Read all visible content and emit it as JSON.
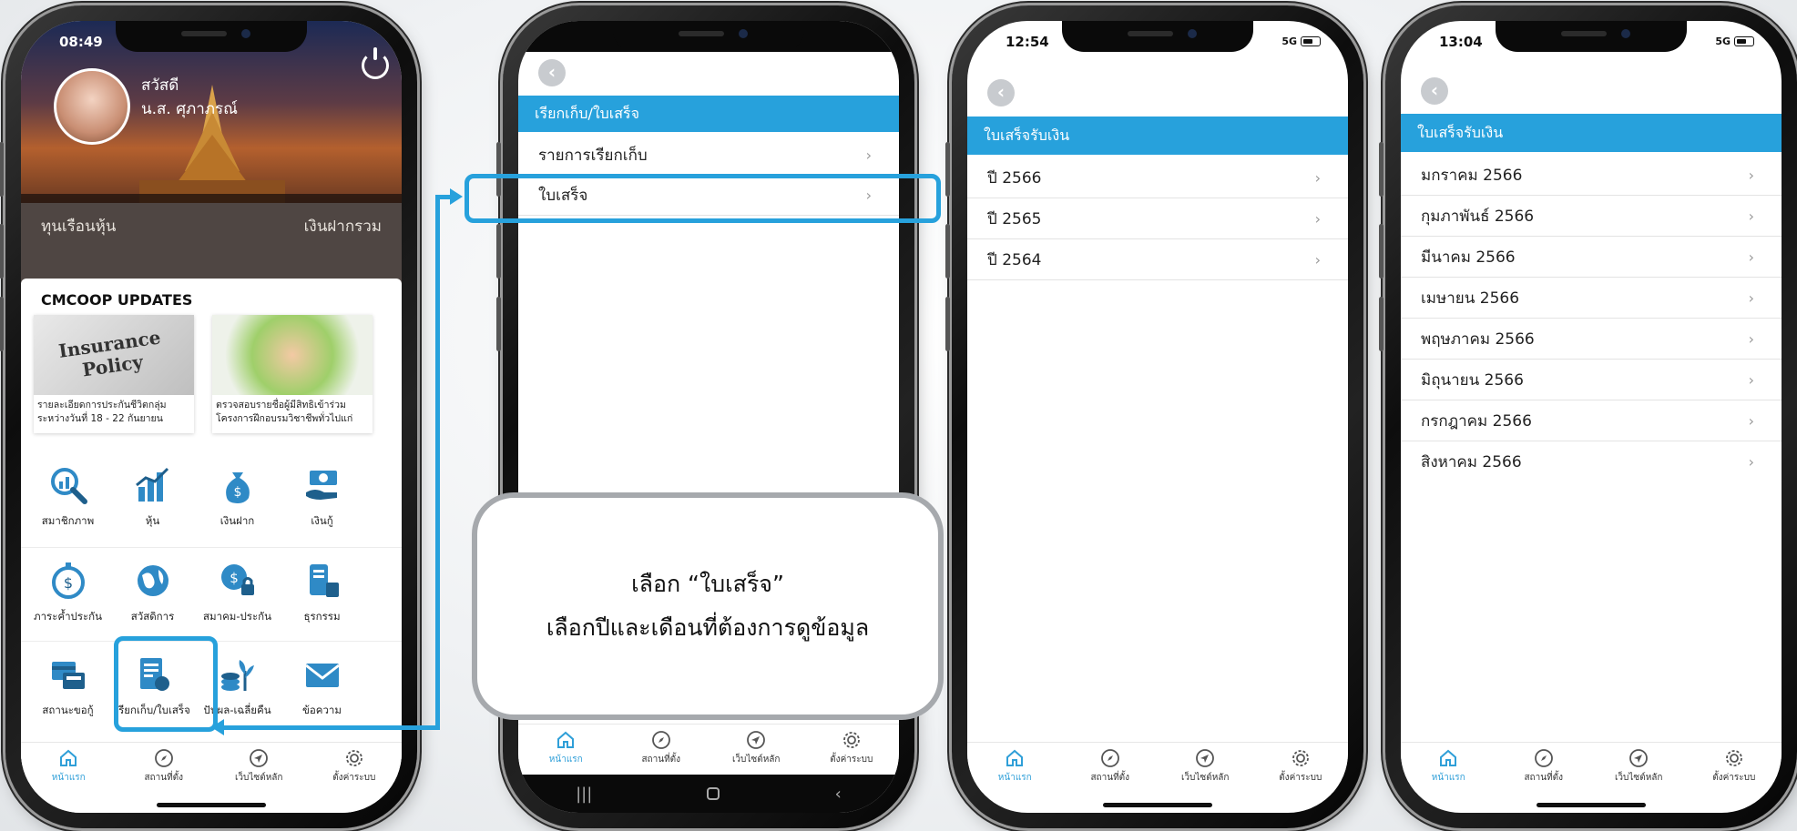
{
  "phone1": {
    "time": "08:49",
    "greeting": "สวัสดี",
    "user_name": "น.ส. ศุภาภรณ์",
    "band_left": "ทุนเรือนหุ้น",
    "band_right": "เงินฝากรวม",
    "updates_title": "CMCOOP UPDATES",
    "news": [
      {
        "image_text": "Insurance Policy",
        "caption": "รายละเอียดการประกันชีวิตกลุ่ม ระหว่างวันที่ 18 - 22 กันยายน"
      },
      {
        "caption": "ตรวจสอบรายชื่อผู้มีสิทธิเข้าร่วม โครงการฝึกอบรมวิชาชีพทั่วไปแก่"
      }
    ],
    "grid": [
      {
        "label": "สมาชิกภาพ",
        "icon": "magnifier-chart-icon"
      },
      {
        "label": "หุ้น",
        "icon": "bar-chart-icon"
      },
      {
        "label": "เงินฝาก",
        "icon": "money-bag-icon"
      },
      {
        "label": "เงินกู้",
        "icon": "cash-hand-icon"
      },
      {
        "label": "ภาระค้ำประกัน",
        "icon": "stopwatch-coin-icon"
      },
      {
        "label": "สวัสดิการ",
        "icon": "globe-icon"
      },
      {
        "label": "สมาคม-ประกัน",
        "icon": "coin-lock-icon"
      },
      {
        "label": "ธุรกรรม",
        "icon": "document-transfer-icon"
      },
      {
        "label": "สถานะขอกู้",
        "icon": "card-terminal-icon"
      },
      {
        "label": "เรียกเก็บ/ใบเสร็จ",
        "icon": "receipt-icon"
      },
      {
        "label": "ปันผล-เฉลี่ยคืน",
        "icon": "coin-plant-icon"
      },
      {
        "label": "ข้อความ",
        "icon": "envelope-icon"
      }
    ]
  },
  "tabs": [
    {
      "label": "หน้าแรก",
      "icon": "home-icon"
    },
    {
      "label": "สถานที่ตั้ง",
      "icon": "compass-icon"
    },
    {
      "label": "เว็บไซต์หลัก",
      "icon": "navigation-icon"
    },
    {
      "label": "ตั้งค่าระบบ",
      "icon": "gear-icon"
    }
  ],
  "phone2": {
    "header": "เรียกเก็บ/ใบเสร็จ",
    "items": [
      "รายการเรียกเก็บ",
      "ใบเสร็จ"
    ]
  },
  "phone3": {
    "time": "12:54",
    "network": "5G",
    "header": "ใบเสร็จรับเงิน",
    "items": [
      "ปี 2566",
      "ปี 2565",
      "ปี 2564"
    ]
  },
  "phone4": {
    "time": "13:04",
    "network": "5G",
    "header": "ใบเสร็จรับเงิน",
    "items": [
      "มกราคม 2566",
      "กุมภาพันธ์ 2566",
      "มีนาคม 2566",
      "เมษายน 2566",
      "พฤษภาคม 2566",
      "มิถุนายน 2566",
      "กรกฎาคม 2566",
      "สิงหาคม 2566"
    ]
  },
  "callout": {
    "line1": "เลือก “ใบเสร็จ”",
    "line2": "เลือกปีและเดือนที่ต้องการดูข้อมูล"
  },
  "colors": {
    "accent": "#27a1dc",
    "callout_border": "#a6a9ad"
  }
}
